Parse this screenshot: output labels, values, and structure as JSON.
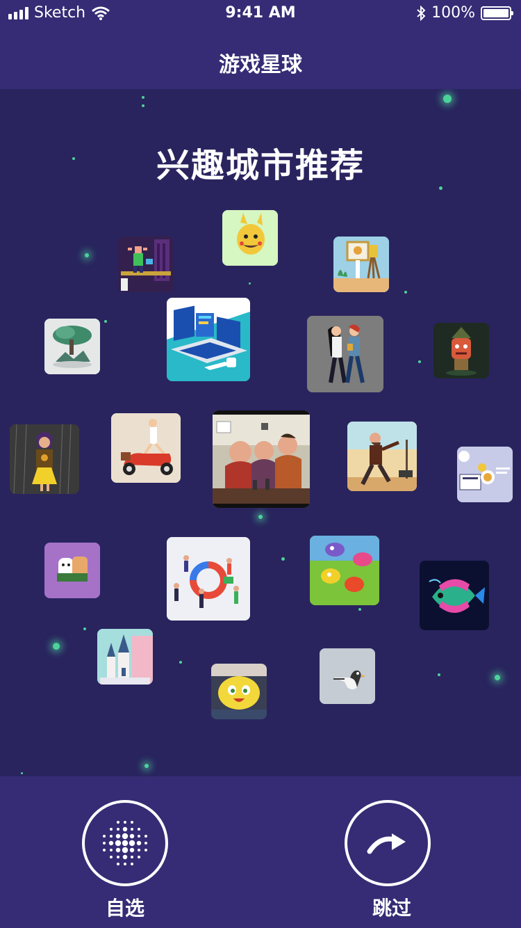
{
  "status": {
    "carrier": "Sketch",
    "time": "9:41 AM",
    "battery": "100%",
    "battery_level": 1.0
  },
  "nav": {
    "title": "游戏星球"
  },
  "main": {
    "headline": "兴趣城市推荐"
  },
  "tiles": [
    {
      "name": "pikachu-mustache-illustration",
      "icon": "pikachu-face",
      "color": "#d6f6c2"
    },
    {
      "name": "pixel-room-character",
      "icon": "pixel-room",
      "color": "#33204e"
    },
    {
      "name": "painter-easel-illustration",
      "icon": "easel",
      "color": "#9ed0e6"
    },
    {
      "name": "bonsai-tree-sculpture",
      "icon": "bonsai-tree",
      "color": "#e6e8e8"
    },
    {
      "name": "dashboard-laptop-isometric",
      "icon": "laptop-dashboard",
      "color": "#29b9c8"
    },
    {
      "name": "two-women-walking",
      "icon": "walking-women",
      "color": "#7d7d7d"
    },
    {
      "name": "red-goblin-3d",
      "icon": "goblin",
      "color": "#1f2b22"
    },
    {
      "name": "girl-in-rain",
      "icon": "rain-girl",
      "color": "#3a3a3a"
    },
    {
      "name": "scooter-rider",
      "icon": "scooter",
      "color": "#ebe0cf"
    },
    {
      "name": "men-at-bar-cartoon",
      "icon": "bar-scene",
      "color": "#c9c3b2"
    },
    {
      "name": "running-man-desert",
      "icon": "running-man",
      "color": "#f0d8a6"
    },
    {
      "name": "newspaper-ui-card",
      "icon": "newspaper",
      "color": "#c8cbe8"
    },
    {
      "name": "bread-character",
      "icon": "bread",
      "color": "#a572c8"
    },
    {
      "name": "isometric-team-meeting",
      "icon": "team-meeting",
      "color": "#eef0f5"
    },
    {
      "name": "colorful-fish-creatures",
      "icon": "fish-creatures",
      "color": "#7cc43a"
    },
    {
      "name": "neon-discus-fish",
      "icon": "discus-fish",
      "color": "#0c1030"
    },
    {
      "name": "pastel-castle",
      "icon": "castle",
      "color": "#a6dede"
    },
    {
      "name": "yellow-chick-cartoon",
      "icon": "chick",
      "color": "#3a3f54"
    },
    {
      "name": "minimal-bird",
      "icon": "bird",
      "color": "#c5ccd3"
    }
  ],
  "bottom": {
    "choose_label": "自选",
    "skip_label": "跳过"
  }
}
